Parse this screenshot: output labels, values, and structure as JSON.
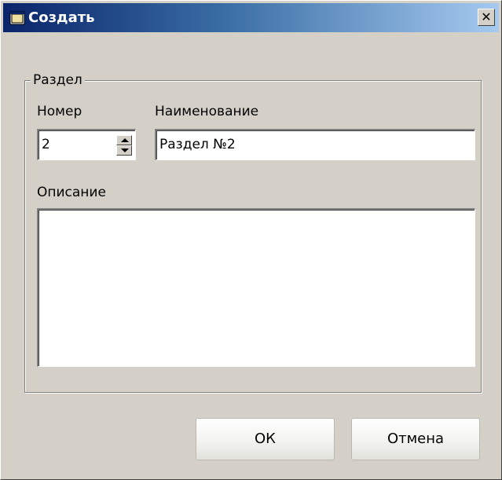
{
  "window": {
    "title": "Создать",
    "close_glyph": "✕",
    "icon": "window-icon"
  },
  "group": {
    "legend": "Раздел",
    "number_label": "Номер",
    "number_value": "2",
    "name_label": "Наименование",
    "name_value": "Раздел №2",
    "description_label": "Описание",
    "description_value": ""
  },
  "buttons": {
    "ok_label": "ОК",
    "cancel_label": "Отмена"
  },
  "colors": {
    "title_start": "#0a246a",
    "title_end": "#a6caf0",
    "dialog_bg": "#d4d0c8"
  }
}
